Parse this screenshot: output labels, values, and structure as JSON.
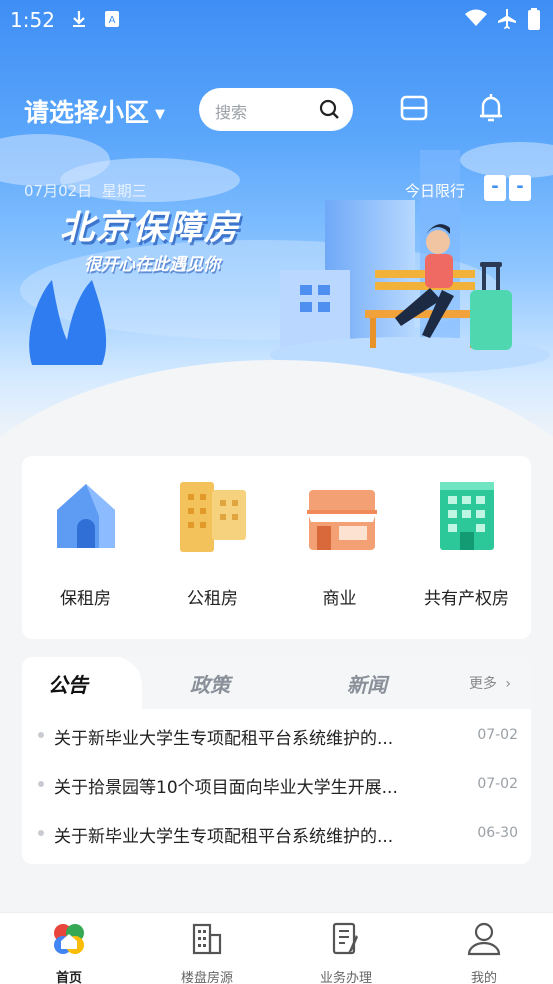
{
  "status_bar": {
    "time": "1:52",
    "icons": [
      "download-icon",
      "a-box-icon",
      "wifi-icon",
      "airplane-icon",
      "battery-icon"
    ]
  },
  "header": {
    "community_select": "请选择小区",
    "search_placeholder": "搜索",
    "icons": [
      "scan-icon",
      "bell-icon"
    ]
  },
  "hero": {
    "date": "07月02日",
    "weekday": "星期三",
    "limit_label": "今日限行",
    "plates": [
      "-",
      "-"
    ],
    "title": "北京保障房",
    "subtitle": "很开心在此遇见你"
  },
  "categories": [
    {
      "label": "保租房",
      "icon": "house-icon",
      "color": "#4f8ff0"
    },
    {
      "label": "公租房",
      "icon": "apartments-icon",
      "color": "#f2b84a"
    },
    {
      "label": "商业",
      "icon": "shop-icon",
      "color": "#f08a5a"
    },
    {
      "label": "共有产权房",
      "icon": "building-icon",
      "color": "#2cc89a"
    }
  ],
  "news": {
    "tabs": [
      {
        "label": "公告",
        "active": true
      },
      {
        "label": "政策",
        "active": false
      },
      {
        "label": "新闻",
        "active": false
      }
    ],
    "more": "更多",
    "items": [
      {
        "title": "关于新毕业大学生专项配租平台系统维护的...",
        "date": "07-02"
      },
      {
        "title": "关于拾景园等10个项目面向毕业大学生开展...",
        "date": "07-02"
      },
      {
        "title": "关于新毕业大学生专项配租平台系统维护的...",
        "date": "06-30"
      }
    ]
  },
  "bottom_nav": [
    {
      "label": "首页",
      "icon": "home-logo-icon",
      "active": true
    },
    {
      "label": "楼盘房源",
      "icon": "building-list-icon",
      "active": false
    },
    {
      "label": "业务办理",
      "icon": "document-edit-icon",
      "active": false
    },
    {
      "label": "我的",
      "icon": "user-icon",
      "active": false
    }
  ],
  "colors": {
    "primary": "#3f8ef5",
    "background": "#f4f5f7"
  }
}
